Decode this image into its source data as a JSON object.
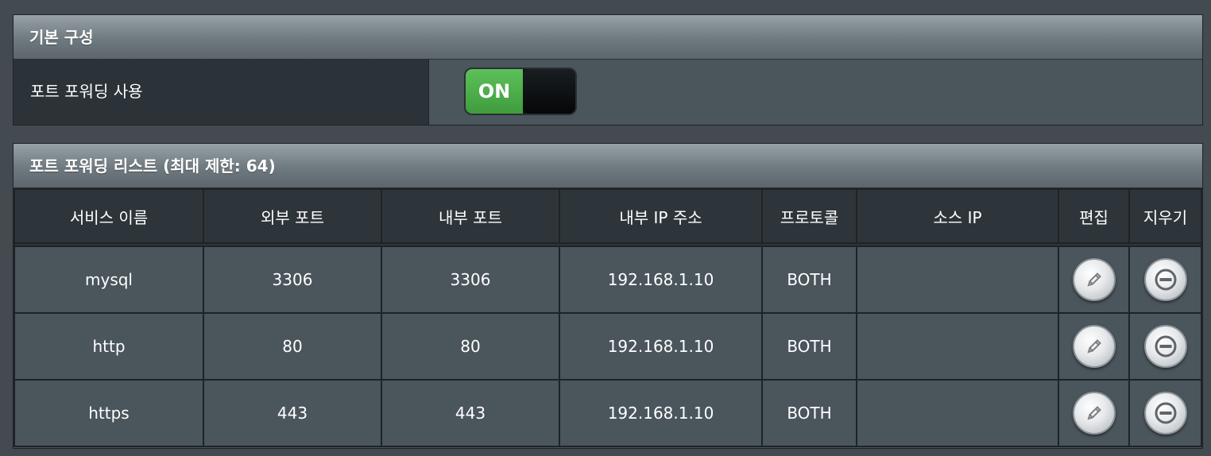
{
  "basic": {
    "title": "기본 구성",
    "port_forwarding_label": "포트 포워딩 사용",
    "toggle_state": "ON"
  },
  "list": {
    "title": "포트 포워딩 리스트 (최대 제한: 64)",
    "headers": [
      "서비스 이름",
      "외부 포트",
      "내부 포트",
      "내부 IP 주소",
      "프로토콜",
      "소스 IP",
      "편집",
      "지우기"
    ],
    "rows": [
      {
        "service": "mysql",
        "external_port": "3306",
        "internal_port": "3306",
        "internal_ip": "192.168.1.10",
        "protocol": "BOTH",
        "source_ip": ""
      },
      {
        "service": "http",
        "external_port": "80",
        "internal_port": "80",
        "internal_ip": "192.168.1.10",
        "protocol": "BOTH",
        "source_ip": ""
      },
      {
        "service": "https",
        "external_port": "443",
        "internal_port": "443",
        "internal_ip": "192.168.1.10",
        "protocol": "BOTH",
        "source_ip": ""
      }
    ],
    "edit_icon": "pencil-icon",
    "delete_icon": "minus-circle-icon"
  },
  "colors": {
    "toggle_on": "#4cae4a",
    "background": "#434a50",
    "cell": "#4a555c",
    "header_cell": "#2e353a"
  }
}
